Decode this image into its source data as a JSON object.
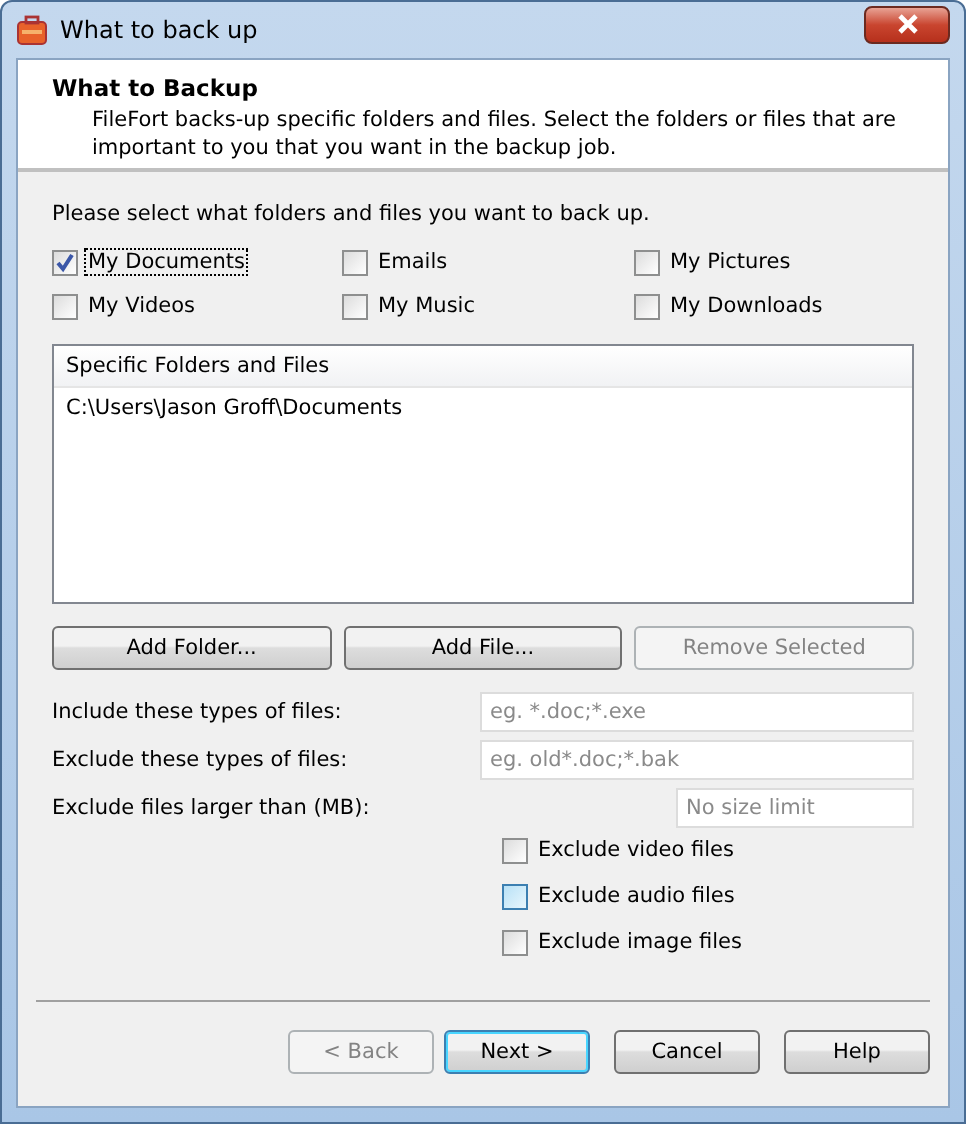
{
  "window": {
    "title": "What to back up"
  },
  "header": {
    "title": "What to Backup",
    "description": "FileFort backs-up specific folders and files. Select the folders or files that are important to you that you want in the backup job."
  },
  "prompt": "Please select what folders and files you want to back up.",
  "locations": [
    {
      "label": "My Documents",
      "checked": true,
      "focused": true
    },
    {
      "label": "Emails",
      "checked": false,
      "focused": false
    },
    {
      "label": "My Pictures",
      "checked": false,
      "focused": false
    },
    {
      "label": "My Videos",
      "checked": false,
      "focused": false
    },
    {
      "label": "My Music",
      "checked": false,
      "focused": false
    },
    {
      "label": "My Downloads",
      "checked": false,
      "focused": false
    }
  ],
  "list": {
    "heading": "Specific Folders and Files",
    "items": [
      "C:\\Users\\Jason Groff\\Documents"
    ]
  },
  "list_buttons": [
    {
      "label": "Add Folder...",
      "disabled": false
    },
    {
      "label": "Add File...",
      "disabled": false
    },
    {
      "label": "Remove Selected",
      "disabled": true
    }
  ],
  "filters": [
    {
      "label": "Include these types of files:",
      "placeholder": "eg. *.doc;*.exe",
      "kind": "wide"
    },
    {
      "label": "Exclude these types of files:",
      "placeholder": "eg. old*.doc;*.bak",
      "kind": "wide"
    },
    {
      "label": "Exclude files larger than (MB):",
      "placeholder": "No size limit",
      "kind": "narrow"
    }
  ],
  "exclusions": [
    {
      "label": "Exclude video files",
      "checked": false,
      "hovered": false
    },
    {
      "label": "Exclude audio files",
      "checked": false,
      "hovered": true
    },
    {
      "label": "Exclude image files",
      "checked": false,
      "hovered": false
    }
  ],
  "buttons": [
    {
      "label": "< Back",
      "disabled": true,
      "default": false
    },
    {
      "label": "Next >",
      "disabled": false,
      "default": true
    },
    {
      "label": "Cancel",
      "disabled": false,
      "default": false
    },
    {
      "label": "Help",
      "disabled": false,
      "default": false
    }
  ]
}
